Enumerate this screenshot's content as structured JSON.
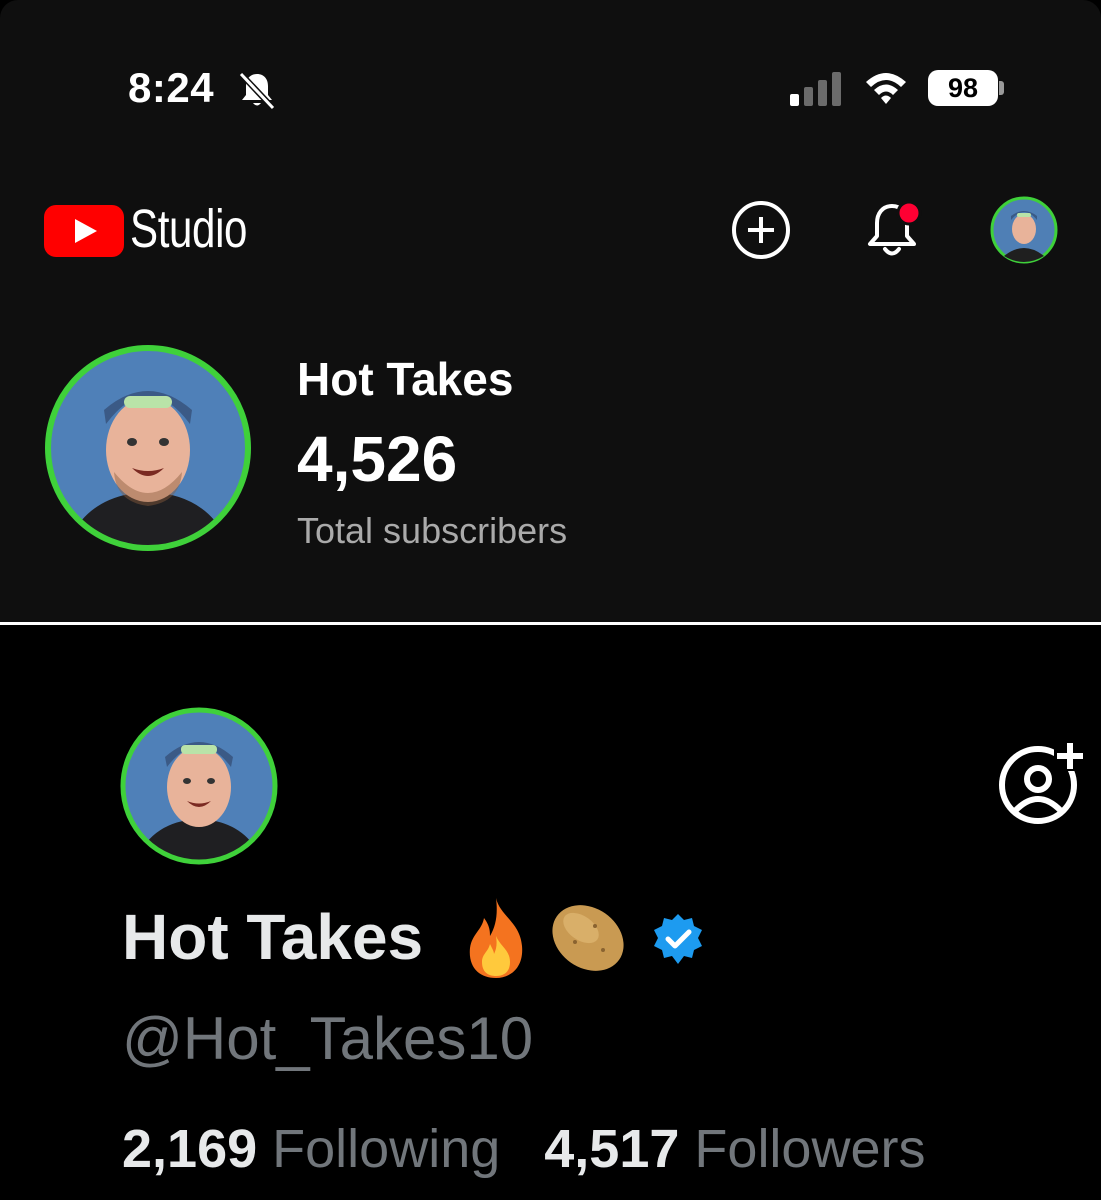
{
  "status_bar": {
    "time": "8:24",
    "battery": "98"
  },
  "studio_header": {
    "logo_text": "Studio"
  },
  "channel": {
    "name": "Hot Takes",
    "subscriber_count": "4,526",
    "subscriber_label": "Total subscribers"
  },
  "x_profile": {
    "name": "Hot Takes",
    "handle": "@Hot_Takes10",
    "following_count": "2,169",
    "following_label": "Following",
    "followers_count": "4,517",
    "followers_label": "Followers"
  },
  "colors": {
    "youtube_red": "#ff0000",
    "avatar_ring": "#3fd13a",
    "verified_blue": "#1d9bf0",
    "notification_dot": "#ff0033"
  }
}
